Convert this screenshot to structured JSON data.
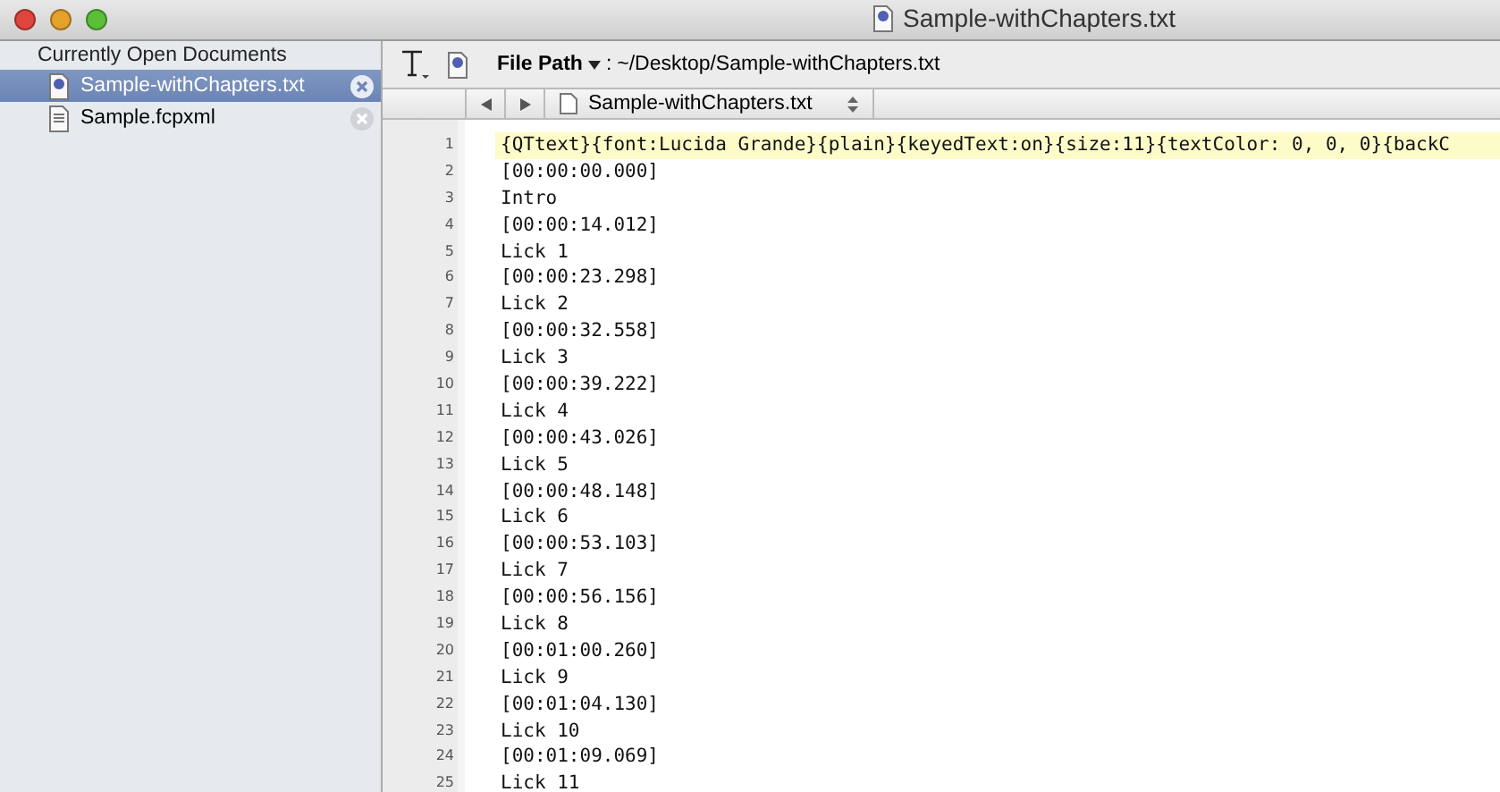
{
  "window": {
    "title": "Sample-withChapters.txt"
  },
  "sidebar": {
    "heading": "Currently Open Documents",
    "items": [
      {
        "label": "Sample-withChapters.txt",
        "selected": true,
        "kind": "text"
      },
      {
        "label": "Sample.fcpxml",
        "selected": false,
        "kind": "xml"
      }
    ]
  },
  "toolbar": {
    "path_label": "File Path",
    "path_separator": ":",
    "path": "~/Desktop/Sample-withChapters.txt"
  },
  "nav": {
    "file": "Sample-withChapters.txt"
  },
  "editor": {
    "lines": [
      {
        "number": "1",
        "text": "{QTtext}{font:Lucida Grande}{plain}{keyedText:on}{size:11}{textColor: 0, 0, 0}{backC",
        "current": true
      },
      {
        "number": "2",
        "text": "[00:00:00.000]",
        "current": false
      },
      {
        "number": "3",
        "text": "Intro",
        "current": false
      },
      {
        "number": "4",
        "text": "[00:00:14.012]",
        "current": false
      },
      {
        "number": "5",
        "text": "Lick 1",
        "current": false
      },
      {
        "number": "6",
        "text": "[00:00:23.298]",
        "current": false
      },
      {
        "number": "7",
        "text": "Lick 2",
        "current": false
      },
      {
        "number": "8",
        "text": "[00:00:32.558]",
        "current": false
      },
      {
        "number": "9",
        "text": "Lick 3",
        "current": false
      },
      {
        "number": "10",
        "text": "[00:00:39.222]",
        "current": false
      },
      {
        "number": "11",
        "text": "Lick 4",
        "current": false
      },
      {
        "number": "12",
        "text": "[00:00:43.026]",
        "current": false
      },
      {
        "number": "13",
        "text": "Lick 5",
        "current": false
      },
      {
        "number": "14",
        "text": "[00:00:48.148]",
        "current": false
      },
      {
        "number": "15",
        "text": "Lick 6",
        "current": false
      },
      {
        "number": "16",
        "text": "[00:00:53.103]",
        "current": false
      },
      {
        "number": "17",
        "text": "Lick 7",
        "current": false
      },
      {
        "number": "18",
        "text": "[00:00:56.156]",
        "current": false
      },
      {
        "number": "19",
        "text": "Lick 8",
        "current": false
      },
      {
        "number": "20",
        "text": "[00:01:00.260]",
        "current": false
      },
      {
        "number": "21",
        "text": "Lick 9",
        "current": false
      },
      {
        "number": "22",
        "text": "[00:01:04.130]",
        "current": false
      },
      {
        "number": "23",
        "text": "Lick 10",
        "current": false
      },
      {
        "number": "24",
        "text": "[00:01:09.069]",
        "current": false
      },
      {
        "number": "25",
        "text": "Lick 11",
        "current": false
      }
    ]
  }
}
